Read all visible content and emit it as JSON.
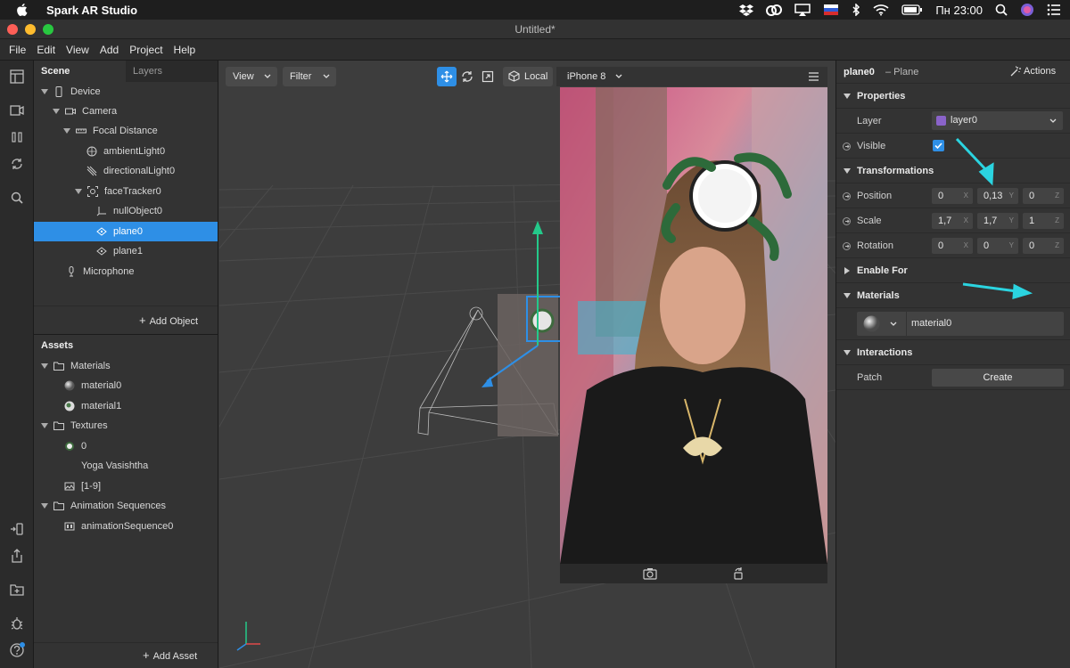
{
  "mac_menubar": {
    "app_name": "Spark AR Studio",
    "clock": "Пн 23:00"
  },
  "window": {
    "title": "Untitled*"
  },
  "app_menu": [
    "File",
    "Edit",
    "View",
    "Add",
    "Project",
    "Help"
  ],
  "scene_panel": {
    "tabs": [
      "Scene",
      "Layers"
    ],
    "items": [
      {
        "label": "Device",
        "icon": "device-icon",
        "expanded": true
      },
      {
        "label": "Camera",
        "icon": "camera-icon",
        "expanded": true
      },
      {
        "label": "Focal Distance",
        "icon": "focal-distance-icon",
        "expanded": true
      },
      {
        "label": "ambientLight0",
        "icon": "ambient-light-icon"
      },
      {
        "label": "directionalLight0",
        "icon": "directional-light-icon"
      },
      {
        "label": "faceTracker0",
        "icon": "face-tracker-icon",
        "expanded": true
      },
      {
        "label": "nullObject0",
        "icon": "null-object-icon"
      },
      {
        "label": "plane0",
        "icon": "plane-icon",
        "selected": true
      },
      {
        "label": "plane1",
        "icon": "plane-icon"
      },
      {
        "label": "Microphone",
        "icon": "microphone-icon"
      }
    ],
    "add_object": "Add Object"
  },
  "assets_panel": {
    "title": "Assets",
    "items": [
      {
        "label": "Materials",
        "icon": "folder-icon",
        "expanded": true
      },
      {
        "label": "material0",
        "icon": "material-sphere-icon"
      },
      {
        "label": "material1",
        "icon": "material-sphere-icon"
      },
      {
        "label": "Textures",
        "icon": "folder-icon",
        "expanded": true
      },
      {
        "label": "0",
        "icon": "texture-icon"
      },
      {
        "label": "Yoga Vasishtha",
        "icon": ""
      },
      {
        "label": "[1-9]",
        "icon": "image-icon"
      },
      {
        "label": "Animation Sequences",
        "icon": "folder-icon",
        "expanded": true
      },
      {
        "label": "animationSequence0",
        "icon": "animation-sequence-icon"
      }
    ],
    "add_asset": "Add Asset"
  },
  "viewport": {
    "view_label": "View",
    "filter_label": "Filter",
    "space_label": "Local",
    "device_label": "iPhone 8"
  },
  "inspector": {
    "object_name": "plane0",
    "object_type": "– Plane",
    "actions_label": "Actions",
    "properties_label": "Properties",
    "layer_label": "Layer",
    "layer_value": "layer0",
    "layer_color": "#8a63c9",
    "visible_label": "Visible",
    "visible": true,
    "transformations_label": "Transformations",
    "position_label": "Position",
    "position": [
      "0",
      "0,13",
      "0"
    ],
    "scale_label": "Scale",
    "scale": [
      "1,7",
      "1,7",
      "1"
    ],
    "rotation_label": "Rotation",
    "rotation": [
      "0",
      "0",
      "0"
    ],
    "axes": [
      "X",
      "Y",
      "Z"
    ],
    "enable_for_label": "Enable For",
    "materials_label": "Materials",
    "material_value": "material0",
    "interactions_label": "Interactions",
    "patch_label": "Patch",
    "create_label": "Create"
  },
  "colors": {
    "accent": "#2e8fe6",
    "annotation_arrow": "#2bd4e0"
  }
}
